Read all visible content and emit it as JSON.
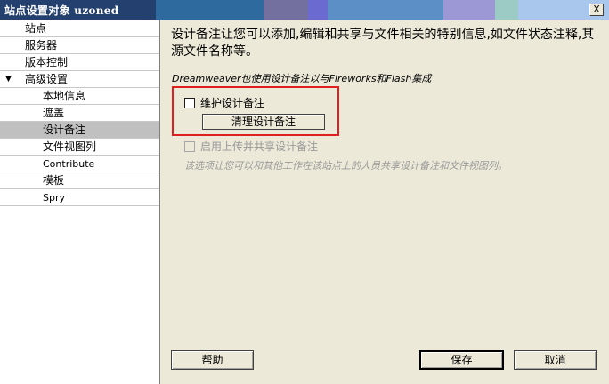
{
  "window": {
    "title_prefix": "站点设置对象",
    "title_site": "uzoned",
    "close_label": "X"
  },
  "sidebar": {
    "items": [
      {
        "label": "站点"
      },
      {
        "label": "服务器"
      },
      {
        "label": "版本控制"
      },
      {
        "label": "高级设置",
        "expanded_marker": "▼"
      },
      {
        "label": "本地信息"
      },
      {
        "label": "遮盖"
      },
      {
        "label": "设计备注"
      },
      {
        "label": "文件视图列"
      },
      {
        "label": "Contribute"
      },
      {
        "label": "模板"
      },
      {
        "label": "Spry"
      }
    ],
    "selected_index": 6
  },
  "main": {
    "description": "设计备注让您可以添加,编辑和共享与文件相关的特别信息,如文件状态注释,其源文件名称等。",
    "integration_note": "Dreamweaver也使用设计备注以与Fireworks和Flash集成",
    "maintain_notes": {
      "label": "维护设计备注",
      "checked": false
    },
    "clean_button": "清理设计备注",
    "share_notes": {
      "label": "启用上传并共享设计备注",
      "checked": false,
      "enabled": false
    },
    "share_description": "该选项让您可以和其他工作在该站点上的人员共享设计备注和文件视图列。"
  },
  "footer": {
    "help": "帮助",
    "save": "保存",
    "cancel": "取消"
  },
  "colors": {
    "highlight_border": "#e02020",
    "selected_item": "#c0c0c0",
    "dialog_bg": "#ece9d8"
  }
}
